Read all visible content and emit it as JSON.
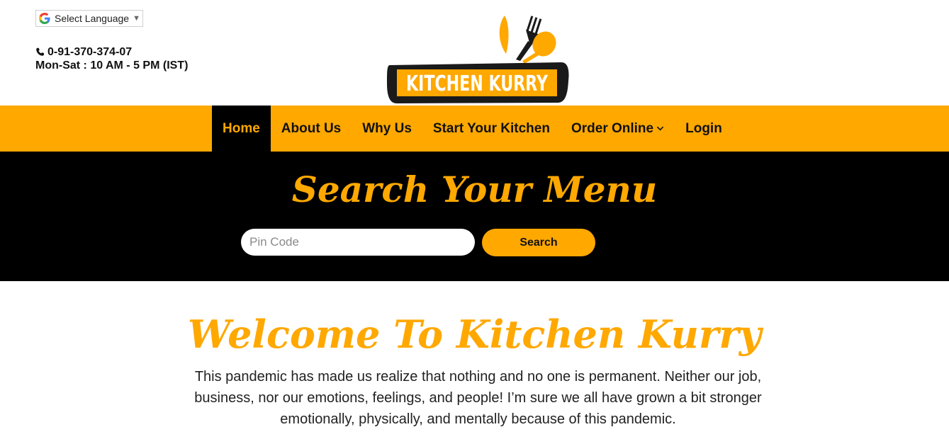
{
  "header": {
    "language_selector": {
      "label": "Select Language",
      "arrow": "▼",
      "icon": "google-g-icon"
    },
    "contact": {
      "phone": "0-91-370-374-07",
      "hours": "Mon-Sat : 10 AM - 5 PM (IST)",
      "icon": "phone-icon"
    },
    "logo": {
      "text": "KITCHEN KURRY",
      "colors": {
        "orange": "#ffa800",
        "dark": "#1a1a1a"
      }
    }
  },
  "nav": {
    "items": [
      {
        "label": "Home",
        "active": true
      },
      {
        "label": "About Us"
      },
      {
        "label": "Why Us"
      },
      {
        "label": "Start Your Kitchen"
      },
      {
        "label": "Order Online",
        "has_dropdown": true
      },
      {
        "label": "Login"
      }
    ]
  },
  "search": {
    "title": "Search Your Menu",
    "input_placeholder": "Pin Code",
    "input_value": "",
    "button_label": "Search"
  },
  "welcome": {
    "title": "Welcome To Kitchen Kurry",
    "body": "This pandemic has made us realize that nothing and no one is permanent. Neither our job, business, nor our emotions, feelings, and people! I’m sure we all have grown a bit stronger emotionally, physically, and mentally because of this pandemic."
  },
  "theme": {
    "accent": "#ffa800",
    "dark": "#000000",
    "text": "#111111"
  }
}
